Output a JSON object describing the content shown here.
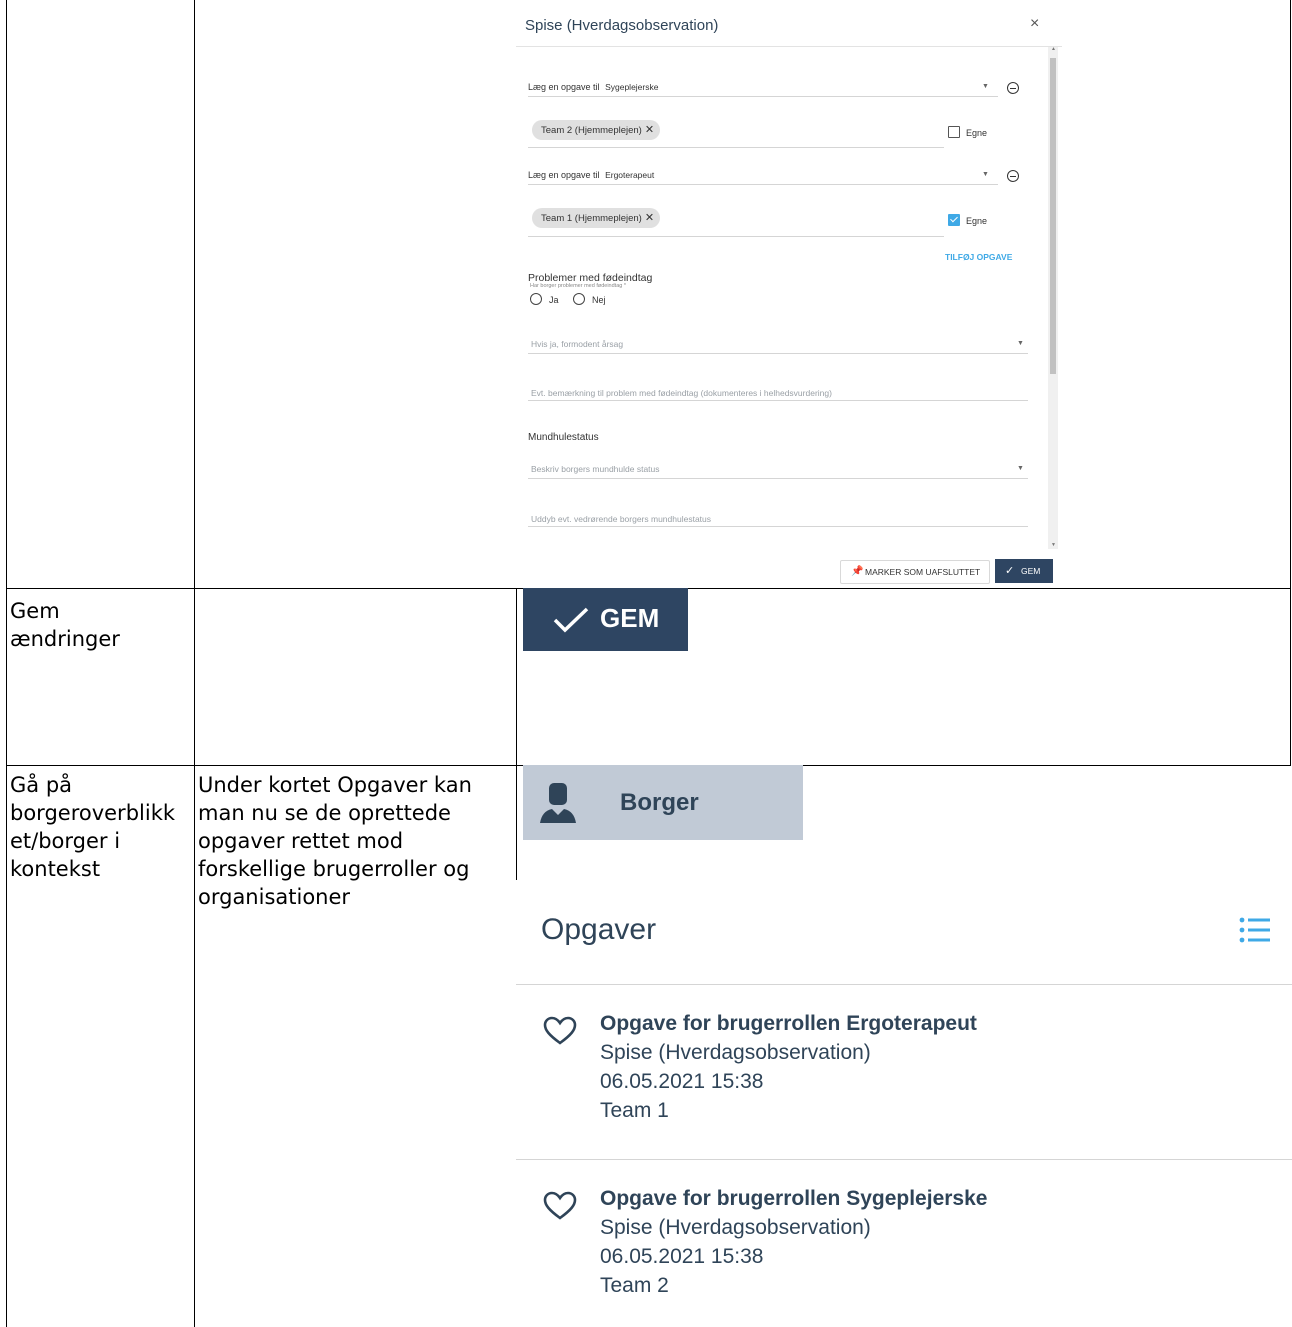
{
  "dialog": {
    "title": "Spise (Hverdagsobservation)",
    "close_symbol": "×",
    "tasks": [
      {
        "label": "Læg en opgave til",
        "role": "Sygeplejerske",
        "chip": "Team 2 (Hjemmeplejen)",
        "own_label": "Egne",
        "own_checked": false
      },
      {
        "label": "Læg en opgave til",
        "role": "Ergoterapeut",
        "chip": "Team 1 (Hjemmeplejen)",
        "own_label": "Egne",
        "own_checked": true
      }
    ],
    "add_task_label": "TILFØJ OPGAVE",
    "problem": {
      "title": "Problemer med fødeindtag",
      "question": "Har borger problemer med fødeindtag *",
      "option_yes": "Ja",
      "option_no": "Nej",
      "reason_placeholder": "Hvis ja, formodent årsag",
      "remark_placeholder": "Evt. bemærkning til problem med fødeindtag (dokumenteres i helhedsvurdering)"
    },
    "mouth": {
      "title": "Mundhulestatus",
      "describe_placeholder": "Beskriv borgers mundhulde status",
      "elaborate_placeholder": "Uddyb evt. vedrørende borgers mundhulestatus"
    },
    "mark_unfinished_label": "MARKER SOM UAFSLUTTET",
    "save_label": "GEM"
  },
  "rows": [
    {
      "col1": "Gem ændringer",
      "col2": ""
    },
    {
      "col1": "Gå på borgeroverblikket/borger i kontekst",
      "col2": "Under kortet Opgaver kan man nu se de oprettede opgaver rettet mod forskellige brugerroller og organisationer"
    }
  ],
  "gem_button": {
    "label": "GEM"
  },
  "borger_button": {
    "label": "Borger"
  },
  "opgaver": {
    "title": "Opgaver",
    "items": [
      {
        "title": "Opgave for brugerrollen Ergoterapeut",
        "activity": "Spise (Hverdagsobservation)",
        "datetime": "06.05.2021 15:38",
        "team": "Team 1"
      },
      {
        "title": "Opgave for brugerrollen Sygeplejerske",
        "activity": "Spise (Hverdagsobservation)",
        "datetime": "06.05.2021 15:38",
        "team": "Team 2"
      }
    ]
  }
}
